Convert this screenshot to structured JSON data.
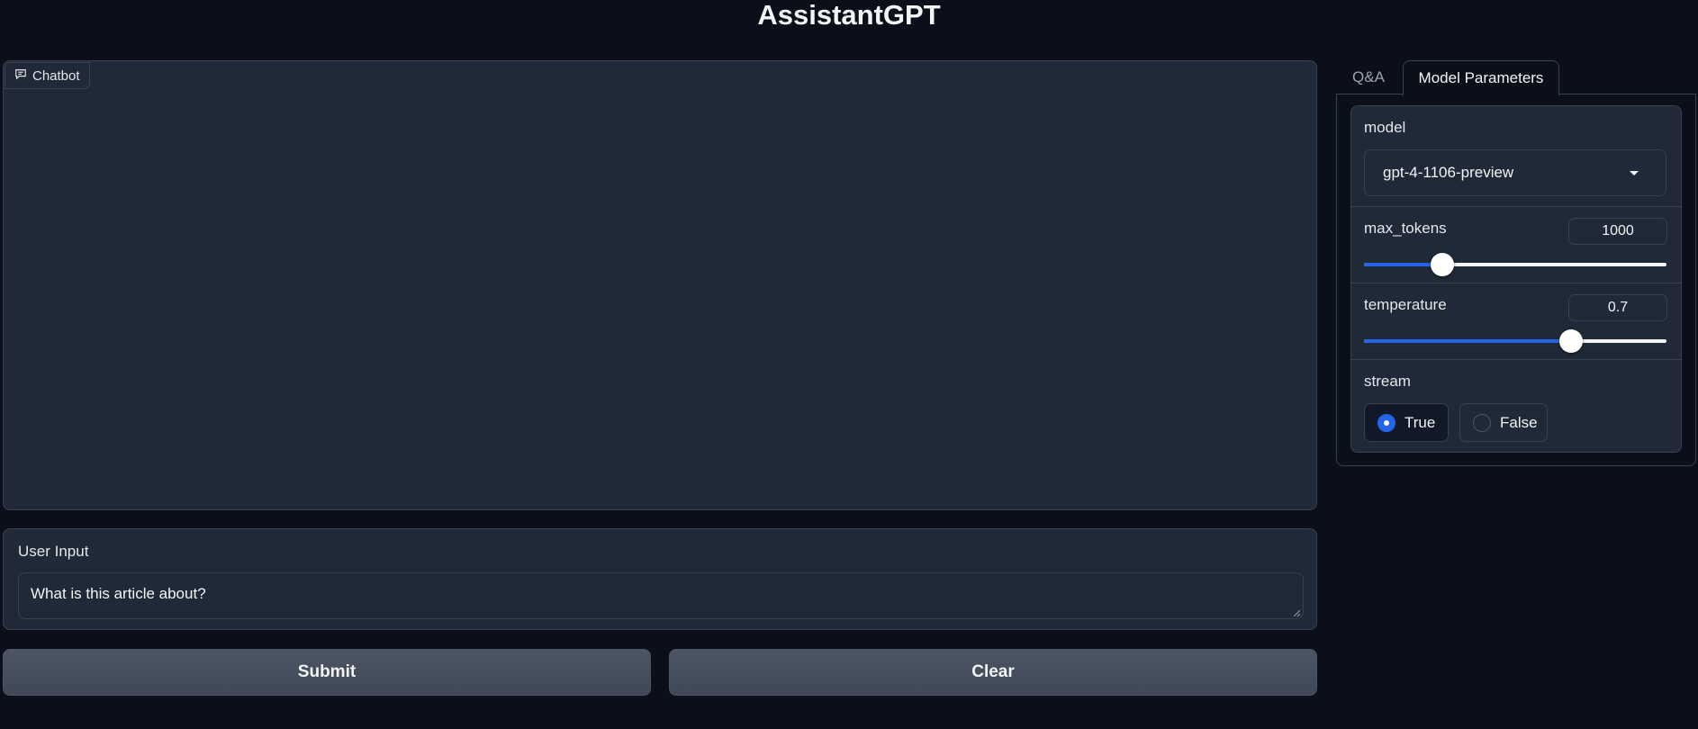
{
  "header": {
    "title": "AssistantGPT"
  },
  "chatbot": {
    "label": "Chatbot",
    "icon": "chat-icon"
  },
  "user_input": {
    "label": "User Input",
    "value": "What is this article about?"
  },
  "buttons": {
    "submit": "Submit",
    "clear": "Clear"
  },
  "tabs": [
    {
      "label": "Q&A",
      "active": false
    },
    {
      "label": "Model Parameters",
      "active": true
    }
  ],
  "params": {
    "model": {
      "label": "model",
      "value": "gpt-4-1106-preview"
    },
    "max_tokens": {
      "label": "max_tokens",
      "value": "1000",
      "slider_fraction": 0.26
    },
    "temperature": {
      "label": "temperature",
      "value": "0.7",
      "slider_fraction": 0.685
    },
    "stream": {
      "label": "stream",
      "options": [
        {
          "label": "True",
          "checked": true
        },
        {
          "label": "False",
          "checked": false
        }
      ]
    }
  },
  "colors": {
    "background": "#0b0f19",
    "panel": "#1f2937",
    "border": "#374151",
    "accent": "#2563eb",
    "button": "#4b5563"
  }
}
